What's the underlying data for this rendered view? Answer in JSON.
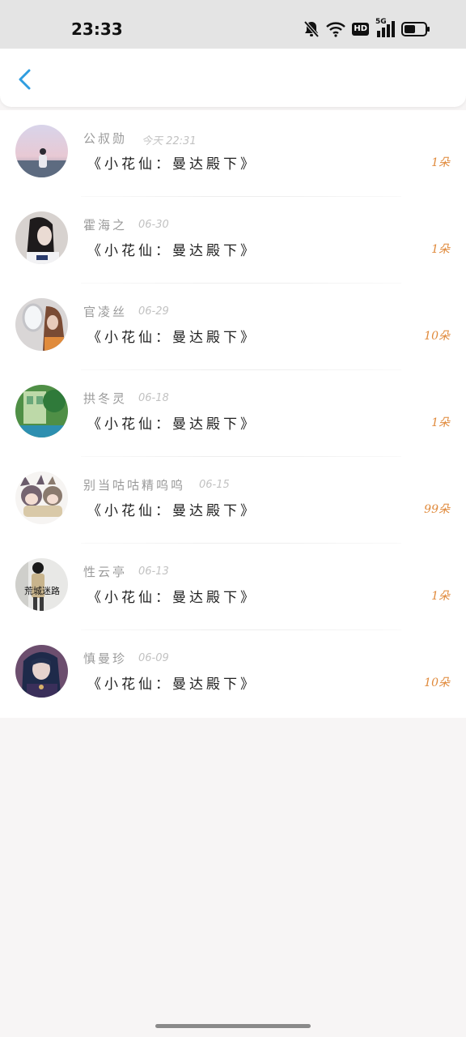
{
  "status_bar": {
    "time": "23:33",
    "icons": [
      "bell-off-icon",
      "wifi-icon",
      "hd-icon",
      "signal-5g-icon",
      "battery-icon"
    ],
    "hd_label": "HD",
    "network_label": "5G"
  },
  "header": {
    "back_icon": "chevron-left-icon",
    "accent_color": "#2f9de0"
  },
  "records": [
    {
      "name": "公叔勋",
      "time": "今天 22:31",
      "gift": "《小花仙：曼达殿下》",
      "count": "1朵"
    },
    {
      "name": "霍海之",
      "time": "06-30",
      "gift": "《小花仙：曼达殿下》",
      "count": "1朵"
    },
    {
      "name": "官凌丝",
      "time": "06-29",
      "gift": "《小花仙：曼达殿下》",
      "count": "10朵"
    },
    {
      "name": "拱冬灵",
      "time": "06-18",
      "gift": "《小花仙：曼达殿下》",
      "count": "1朵"
    },
    {
      "name": "别当咕咕精呜呜",
      "time": "06-15",
      "gift": "《小花仙：曼达殿下》",
      "count": "99朵"
    },
    {
      "name": "性云亭",
      "time": "06-13",
      "gift": "《小花仙：曼达殿下》",
      "count": "1朵",
      "avatar_text": "荒城迷路"
    },
    {
      "name": "慎曼珍",
      "time": "06-09",
      "gift": "《小花仙：曼达殿下》",
      "count": "10朵"
    }
  ],
  "colors": {
    "count": "#e08a3c",
    "name": "#9a9a9a",
    "time": "#c2c2c2",
    "gift": "#222222"
  }
}
